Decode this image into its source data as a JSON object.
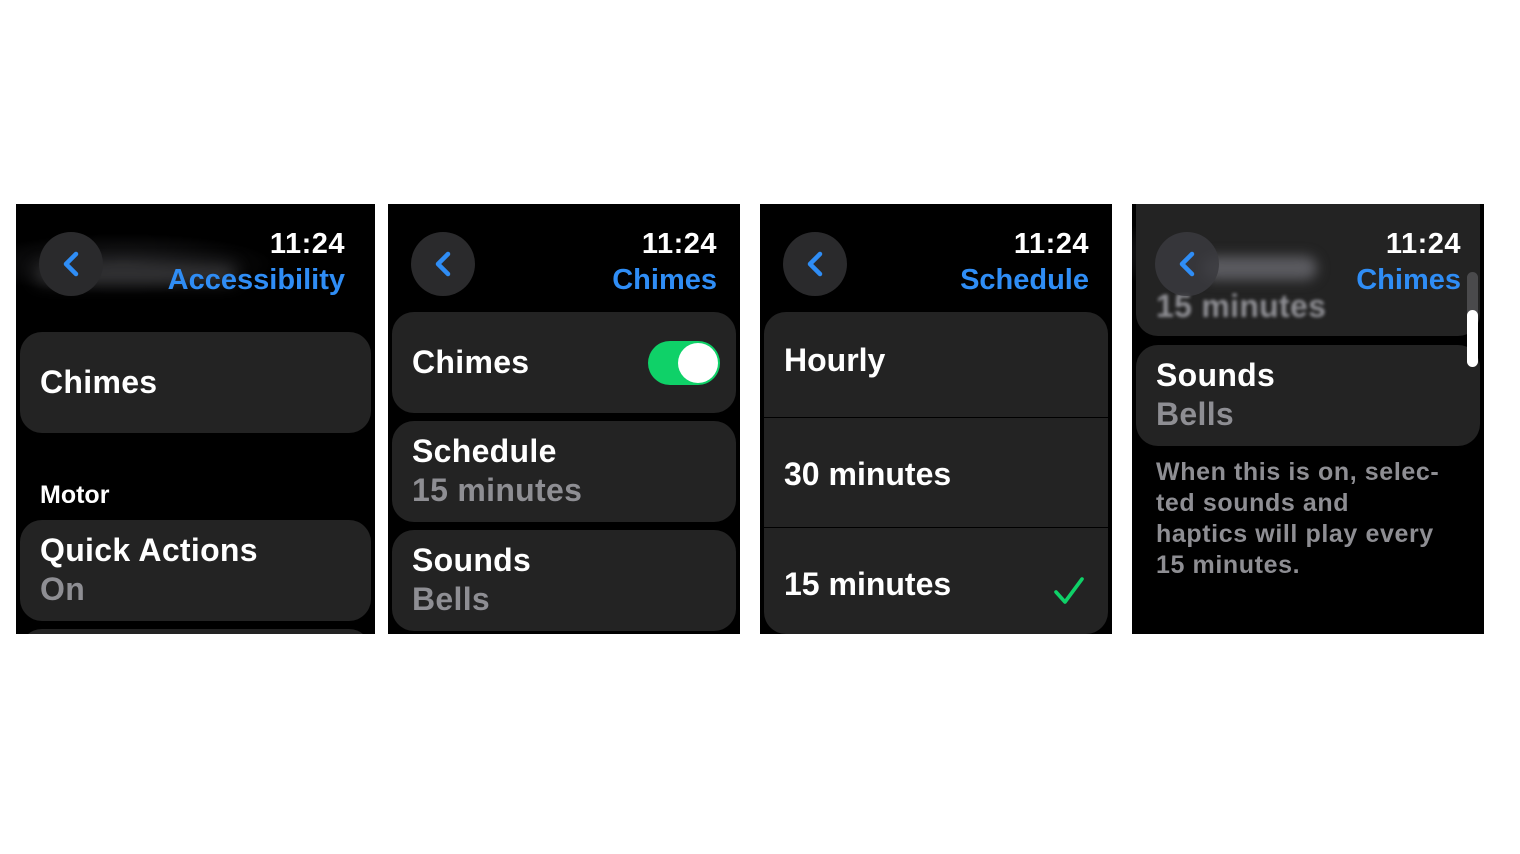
{
  "screens": [
    {
      "id": "accessibility",
      "time": "11:24",
      "nav_title": "Accessibility",
      "items": [
        {
          "title": "Chimes"
        }
      ],
      "section_label": "Motor",
      "section_items": [
        {
          "title": "Quick Actions",
          "value": "On"
        }
      ]
    },
    {
      "id": "chimes",
      "time": "11:24",
      "nav_title": "Chimes",
      "toggle": {
        "label": "Chimes",
        "state": "on"
      },
      "items": [
        {
          "title": "Schedule",
          "value": "15 minutes"
        },
        {
          "title": "Sounds",
          "value": "Bells"
        }
      ]
    },
    {
      "id": "schedule",
      "time": "11:24",
      "nav_title": "Schedule",
      "options": [
        {
          "label": "Hourly",
          "selected": false
        },
        {
          "label": "30 minutes",
          "selected": false
        },
        {
          "label": "15 minutes",
          "selected": true
        }
      ]
    },
    {
      "id": "chimes-scrolled",
      "time": "11:24",
      "nav_title": "Chimes",
      "partial_item_value": "15 minutes",
      "items": [
        {
          "title": "Sounds",
          "value": "Bells"
        }
      ],
      "footer": "When this is on, selec-ted sounds and haptics will play every 15 minutes.",
      "footer_lines": [
        "When this is on, selec-",
        "ted sounds and",
        "haptics will play every",
        "15 minutes."
      ],
      "scroll_position": 0.6
    }
  ],
  "colors": {
    "accent": "#2f8df5",
    "toggle_on": "#0fd168",
    "checkmark": "#0fd168",
    "cell_bg": "#232323",
    "secondary_text": "#8e8e93"
  }
}
